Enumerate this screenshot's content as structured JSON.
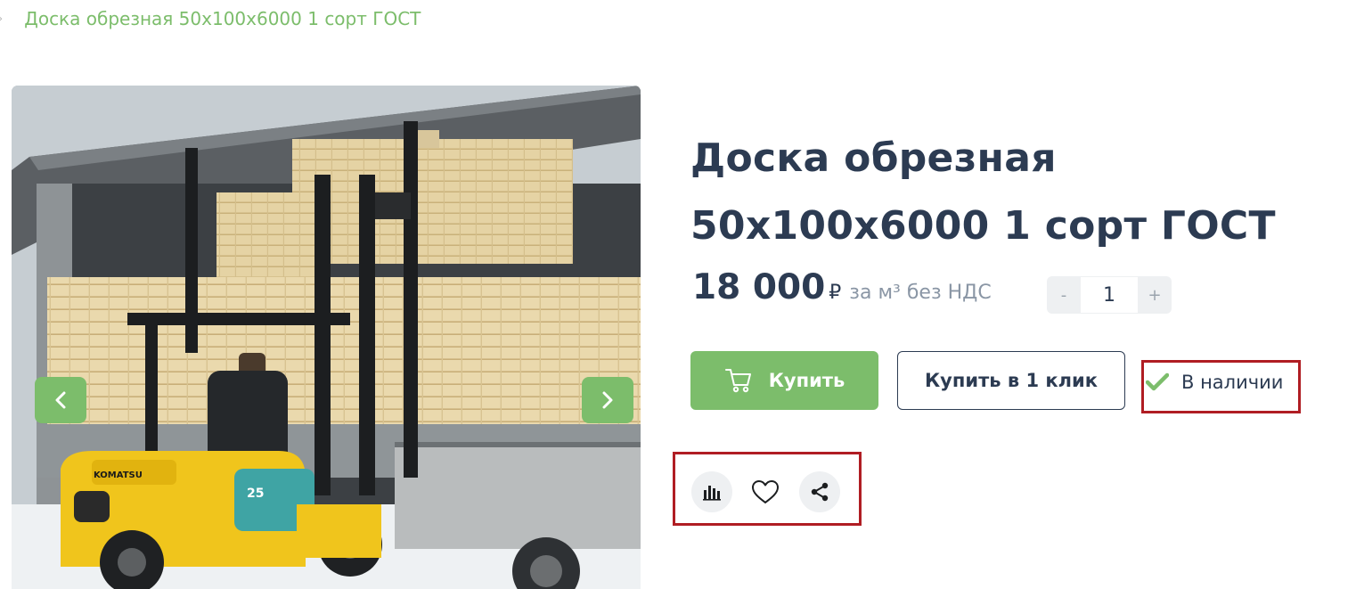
{
  "breadcrumb": {
    "separator": "›",
    "current": "Доска обрезная 50x100x6000 1 сорт ГОСТ"
  },
  "gallery": {
    "image_alt": "Погрузка пиломатериала вилочным погрузчиком",
    "forklift_brand": "KOMATSU",
    "forklift_model": "25",
    "prev_icon": "chevron-left-icon",
    "next_icon": "chevron-right-icon"
  },
  "product": {
    "title": "Доска обрезная 50x100x6000 1 сорт ГОСТ",
    "price": "18 000",
    "currency": "₽",
    "price_unit": "за м³ без НДС"
  },
  "quantity": {
    "minus": "-",
    "value": "1",
    "plus": "+"
  },
  "actions": {
    "buy_label": "Купить",
    "buy_icon": "cart-icon",
    "one_click_label": "Купить в 1 клик",
    "stock_label": "В наличии",
    "stock_icon": "check-icon",
    "secondary": [
      "compare-icon",
      "heart-icon",
      "share-icon"
    ]
  },
  "colors": {
    "accent": "#7cbd6b",
    "text": "#2c3b52",
    "muted": "#8a96a5",
    "highlight": "#b01d23",
    "light_bg": "#eef0f2"
  }
}
